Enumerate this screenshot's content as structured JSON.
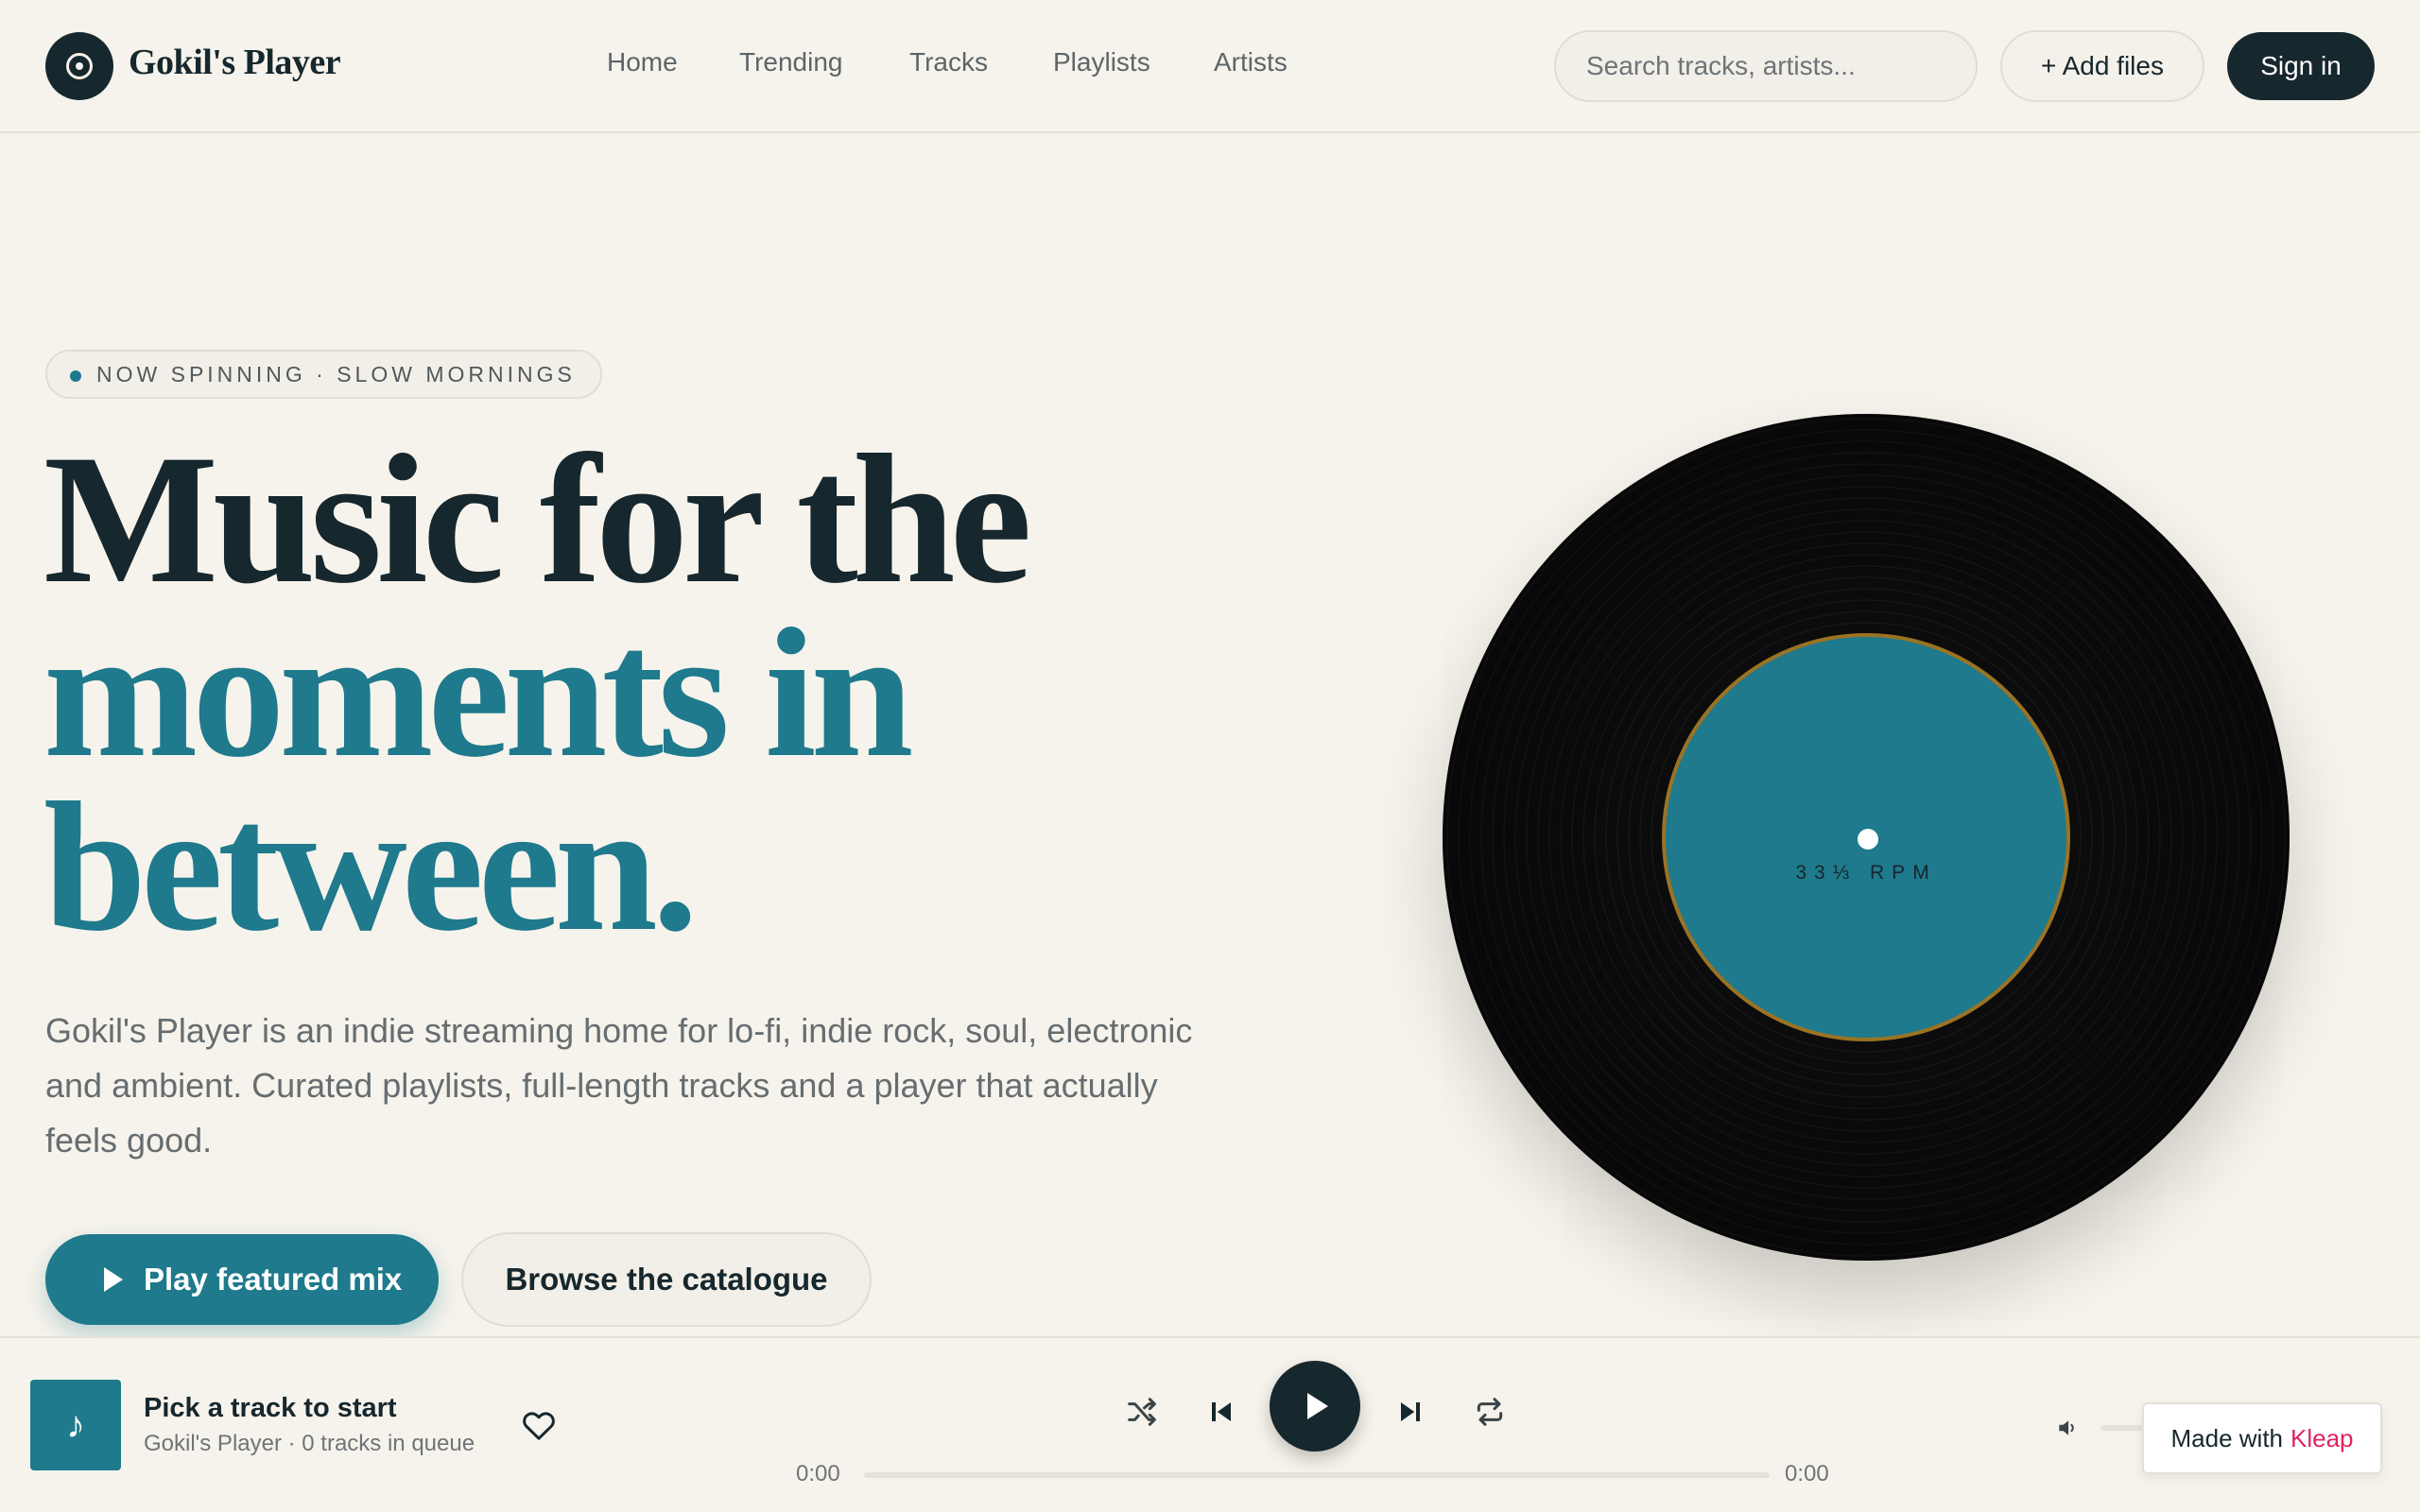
{
  "header": {
    "brand": "Gokil's Player",
    "nav": [
      "Home",
      "Trending",
      "Tracks",
      "Playlists",
      "Artists"
    ],
    "search_placeholder": "Search tracks, artists...",
    "add_files_label": "+ Add files",
    "sign_in_label": "Sign in"
  },
  "hero": {
    "pill": "NOW SPINNING · SLOW MORNINGS",
    "headline_line1": "Music for the",
    "headline_line2": "moments in",
    "headline_line3": "between.",
    "lead": "Gokil's Player is an indie streaming home for lo-fi, indie rock, soul, electronic and ambient. Curated playlists, full-length tracks and a player that actually feels good.",
    "play_button": "Play featured mix",
    "browse_button": "Browse the catalogue",
    "vinyl_label": "33⅓ RPM"
  },
  "player": {
    "cover_icon": "music-note-icon",
    "cover_glyph": "♪",
    "track_title": "Pick a track to start",
    "track_sub": "Gokil's Player · 0 tracks in queue",
    "time_elapsed": "0:00",
    "time_total": "0:00",
    "progress": 0
  },
  "badge": {
    "prefix": "Made with",
    "brand": "Kleap"
  },
  "colors": {
    "accent": "#1e7a8c",
    "dark": "#16272d",
    "background": "#f6f3ec",
    "label_ring": "#9a7324",
    "badge_brand": "#e0245e"
  }
}
